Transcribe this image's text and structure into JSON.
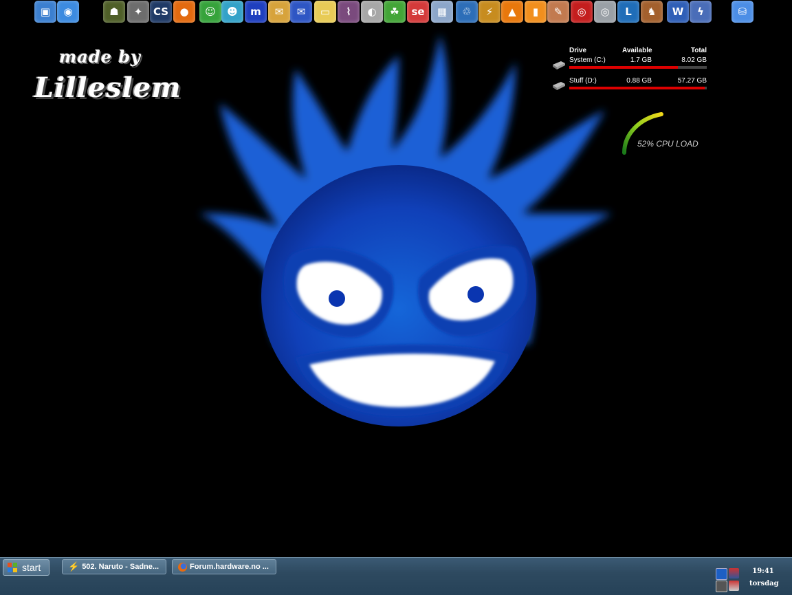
{
  "dock": {
    "icons": [
      {
        "name": "my-computer-icon",
        "glyph": "▣",
        "color": "#3b7fd0"
      },
      {
        "name": "internet-icon",
        "glyph": "◉",
        "color": "#3c8be0"
      },
      {
        "name": "game-monster-icon",
        "glyph": "☗",
        "color": "#4f5f28"
      },
      {
        "name": "counter-strike-icon",
        "glyph": "✦",
        "color": "#6d6d6d"
      },
      {
        "name": "counter-strike-source-icon",
        "glyph": "CS",
        "color": "#1f3a66"
      },
      {
        "name": "firefox-icon",
        "glyph": "●",
        "color": "#e36a0f"
      },
      {
        "name": "msn-messenger-icon",
        "glyph": "☺",
        "color": "#36a33b"
      },
      {
        "name": "messenger-contacts-icon",
        "glyph": "☻",
        "color": "#33a2c8"
      },
      {
        "name": "mirc-icon",
        "glyph": "m",
        "color": "#1f3fbf"
      },
      {
        "name": "mail-envelope-icon",
        "glyph": "✉",
        "color": "#d7a33b"
      },
      {
        "name": "email-icon",
        "glyph": "✉",
        "color": "#2e56c4"
      },
      {
        "name": "folder-icon",
        "glyph": "▭",
        "color": "#e8cb56"
      },
      {
        "name": "purple-app-icon",
        "glyph": "⌇",
        "color": "#7a4a7d"
      },
      {
        "name": "ball-app-icon",
        "glyph": "◐",
        "color": "#a7a7a7"
      },
      {
        "name": "yoshi-icon",
        "glyph": "☘",
        "color": "#43a537"
      },
      {
        "name": "search-engine-icon",
        "glyph": "se",
        "color": "#d43a3a"
      },
      {
        "name": "calculator-icon",
        "glyph": "▦",
        "color": "#8ca6c9"
      },
      {
        "name": "recycle-bin-icon",
        "glyph": "♲",
        "color": "#2d6eb8"
      },
      {
        "name": "winamp-icon",
        "glyph": "⚡",
        "color": "#c78c1f"
      },
      {
        "name": "vlc-icon",
        "glyph": "▲",
        "color": "#e8780c"
      },
      {
        "name": "orange-app-icon",
        "glyph": "▮",
        "color": "#f18f1d"
      },
      {
        "name": "paint-icon",
        "glyph": "✎",
        "color": "#c27a4f"
      },
      {
        "name": "target-icon",
        "glyph": "◎",
        "color": "#c41e1e"
      },
      {
        "name": "cd-burner-icon",
        "glyph": "◎",
        "color": "#9aa0a6"
      },
      {
        "name": "layout-icon",
        "glyph": "L",
        "color": "#1f6db8"
      },
      {
        "name": "fox-app-icon",
        "glyph": "♞",
        "color": "#a3602d"
      },
      {
        "name": "word-icon",
        "glyph": "W",
        "color": "#2f5fb7"
      },
      {
        "name": "speed-app-icon",
        "glyph": "ϟ",
        "color": "#4a6db8"
      },
      {
        "name": "database-icon",
        "glyph": "⛁",
        "color": "#4c8ee6"
      }
    ]
  },
  "branding": {
    "made_by": "made by",
    "author": "Lilleslem"
  },
  "drives_widget": {
    "header_drive": "Drive",
    "header_available": "Available",
    "header_total": "Total",
    "drives": [
      {
        "name": "System (C:)",
        "available": "1.7 GB",
        "total": "8.02 GB",
        "used_fraction": 0.79
      },
      {
        "name": "Stuff (D:)",
        "available": "0.88 GB",
        "total": "57.27 GB",
        "used_fraction": 0.985
      }
    ]
  },
  "cpu_widget": {
    "label": "52% CPU LOAD",
    "load_fraction": 0.52
  },
  "taskbar": {
    "start_label": "start",
    "tasks": [
      {
        "label": "502. Naruto - Sadne..."
      },
      {
        "label": "Forum.hardware.no ..."
      }
    ],
    "clock_time": "19:41",
    "clock_day": "torsdag"
  },
  "colors": {
    "background": "#000000",
    "mascot_blue": "#1e5bd6",
    "bar_red": "#dd0000",
    "taskbar": "#2e4a60"
  }
}
